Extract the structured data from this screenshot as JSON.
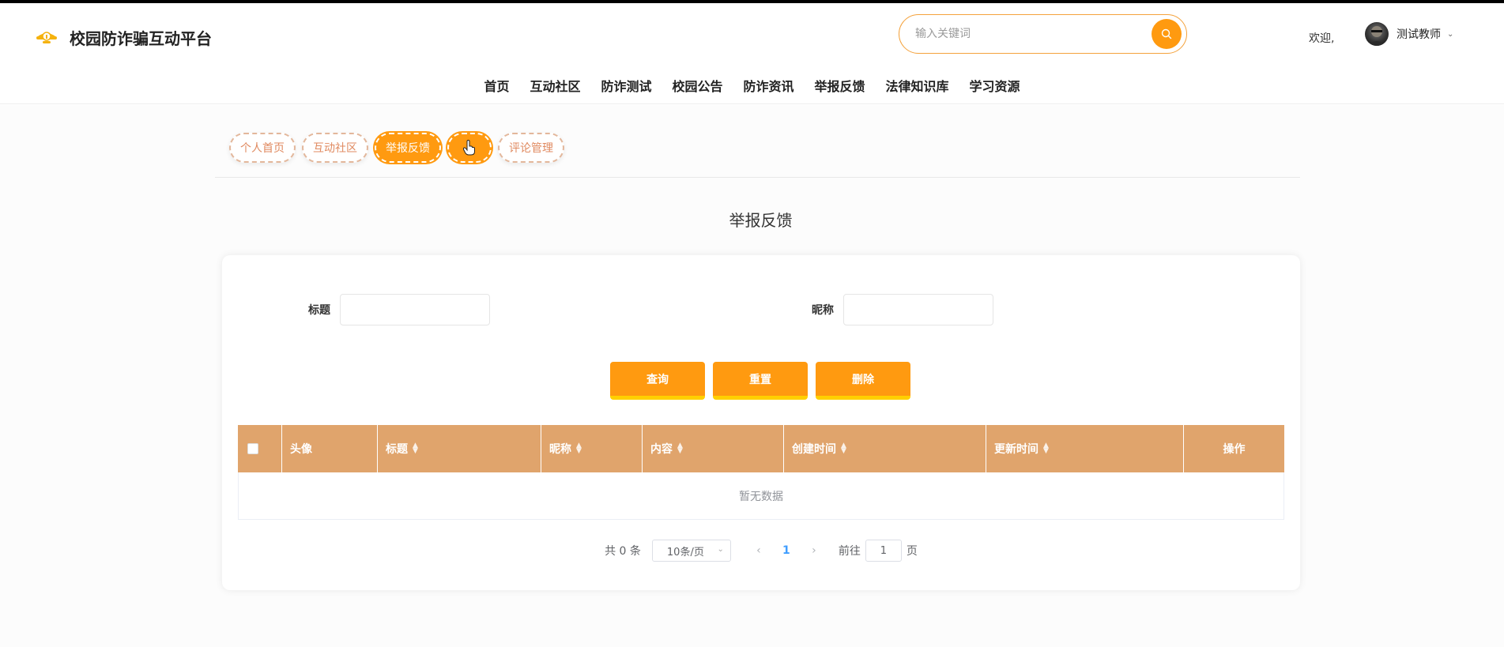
{
  "app": {
    "title": "校园防诈骗互动平台",
    "logo_icon": "lightbulb-icon"
  },
  "header": {
    "search_placeholder": "输入关键词",
    "search_icon": "search-icon",
    "welcome": "欢迎,",
    "username": "测试教师",
    "user_caret": "⌄"
  },
  "nav": {
    "items": [
      {
        "label": "首页"
      },
      {
        "label": "互动社区"
      },
      {
        "label": "防诈测试"
      },
      {
        "label": "校园公告"
      },
      {
        "label": "防诈资讯"
      },
      {
        "label": "举报反馈"
      },
      {
        "label": "法律知识库"
      },
      {
        "label": "学习资源"
      }
    ]
  },
  "subtabs": [
    {
      "label": "个人首页",
      "active": false
    },
    {
      "label": "互动社区",
      "active": false
    },
    {
      "label": "举报反馈",
      "active": true
    },
    {
      "label": "···",
      "active": true
    },
    {
      "label": "评论管理",
      "active": false
    }
  ],
  "page": {
    "title": "举报反馈"
  },
  "filters": {
    "title_label": "标题",
    "title_value": "",
    "nickname_label": "昵称",
    "nickname_value": ""
  },
  "buttons": {
    "query": "查询",
    "reset": "重置",
    "delete": "删除"
  },
  "table": {
    "columns": [
      "",
      "头像",
      "标题",
      "昵称",
      "内容",
      "创建时间",
      "更新时间",
      "操作"
    ],
    "empty_text": "暂无数据"
  },
  "pagination": {
    "total": "共 0 条",
    "page_size": "10条/页",
    "current_page": "1",
    "goto_label": "前往",
    "goto_value": "1",
    "page_suffix": "页"
  },
  "colors": {
    "accent": "#ff9a10",
    "table_header": "#e0a46c"
  }
}
